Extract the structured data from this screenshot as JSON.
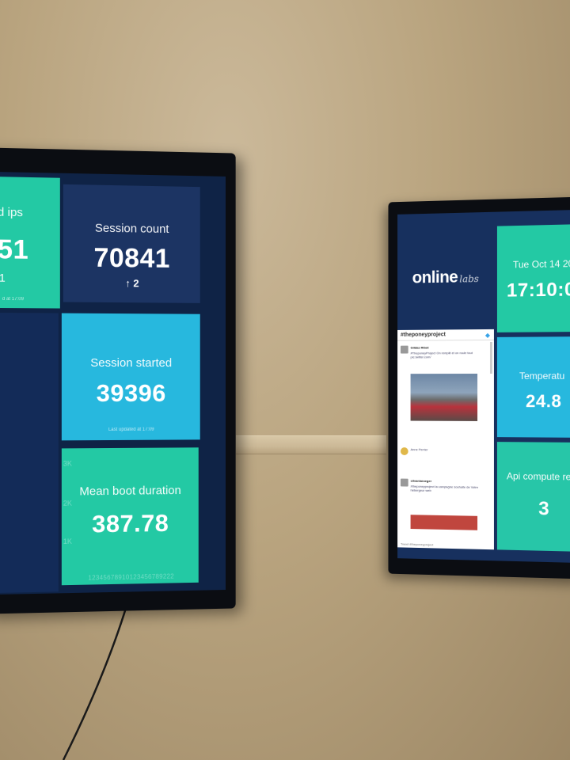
{
  "left_screen": {
    "ips": {
      "title": "d ips",
      "value": "51",
      "delta": "1",
      "updated": "d at 17:09"
    },
    "session_count": {
      "title": "Session count",
      "value": "70841",
      "delta": "2",
      "delta_arrow": "arrow-up-icon"
    },
    "session_started": {
      "title": "Session started",
      "value": "39396",
      "updated": "Last updated at 17:09"
    },
    "mean_boot": {
      "title": "Mean boot duration",
      "value": "387.78",
      "y_ticks": [
        "3K",
        "2K",
        "1K"
      ],
      "x_ticks": "12345678910123456789222"
    }
  },
  "right_screen": {
    "logo": {
      "primary": "online",
      "secondary": "labs"
    },
    "date": {
      "title": "Tue Oct 14 20",
      "value": "17:10:0"
    },
    "temperature": {
      "title": "Temperatu",
      "value": "24.8"
    },
    "api": {
      "title": "Api compute re",
      "value": "3"
    },
    "twitter": {
      "hashtag": "#theponeyproject",
      "tweets": [
        {
          "name": "Gildas Ribot",
          "time": "",
          "text": "#TheponeyProject  On remplit et on roule tout pic.twitter.com/"
        },
        {
          "name": "",
          "time": "",
          "text": "Anne Perrier"
        },
        {
          "name": "silvanlaroeger",
          "time": "",
          "text": "#theponeyproject la campagne souhaite de Votre hébergeur web"
        }
      ],
      "footer": "Tweet #theponeyproject",
      "bird_icon": "twitter-bird-icon"
    }
  },
  "colors": {
    "teal": "#23c9a4",
    "blue": "#27b8de",
    "navy": "#1c3463",
    "wall": "#b9a47f"
  }
}
